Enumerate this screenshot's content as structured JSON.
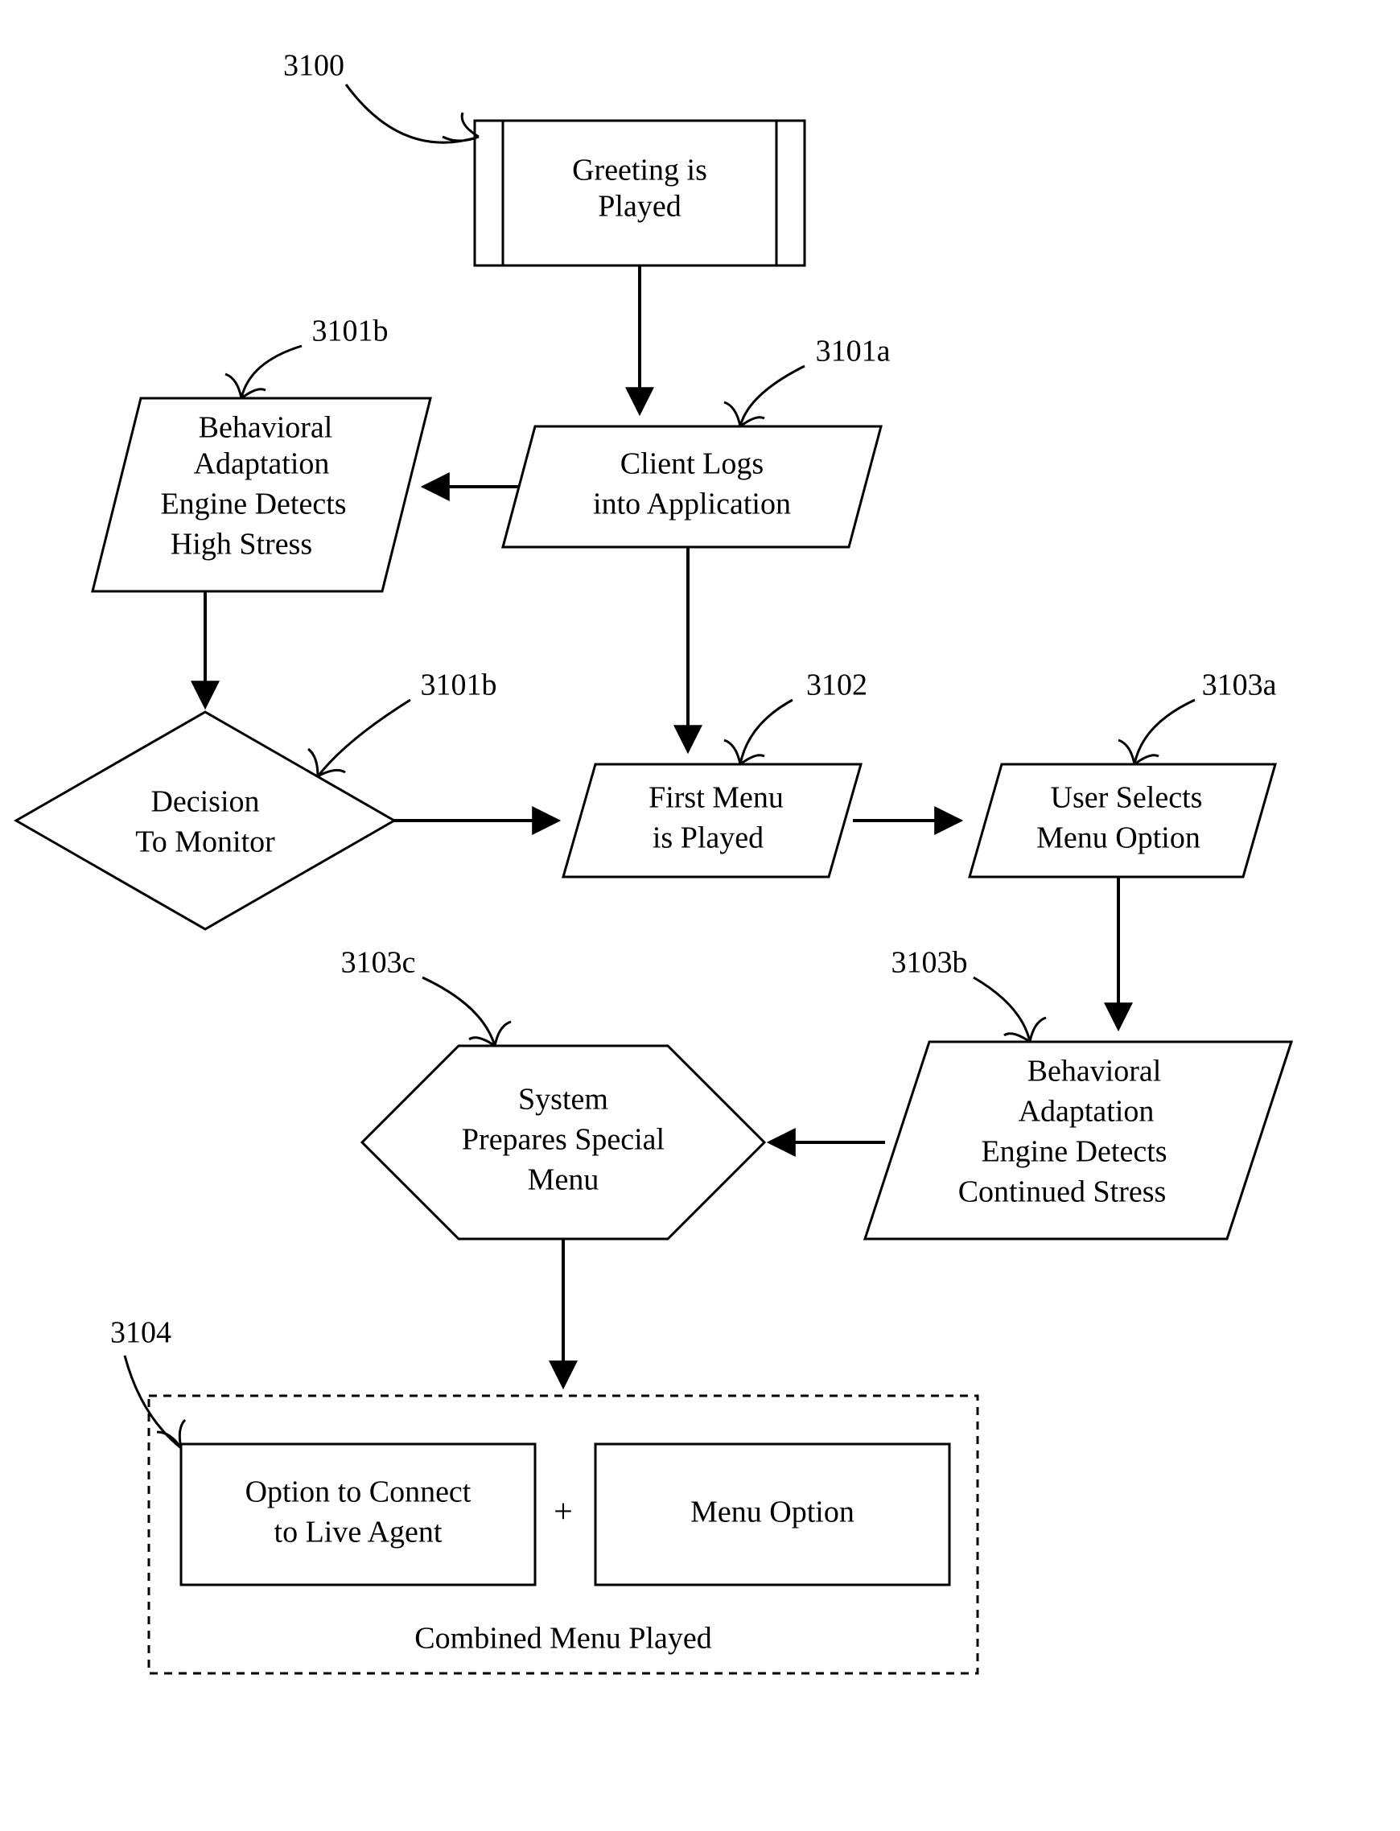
{
  "labels": {
    "l3100": "3100",
    "l3101b_top": "3101b",
    "l3101a": "3101a",
    "l3101b_mid": "3101b",
    "l3102": "3102",
    "l3103a": "3103a",
    "l3103c": "3103c",
    "l3103b": "3103b",
    "l3104": "3104"
  },
  "nodes": {
    "greeting": {
      "l1": "Greeting is",
      "l2": "Played"
    },
    "stress1": {
      "l1": "Behavioral",
      "l2": "Adaptation",
      "l3": "Engine Detects",
      "l4": "High Stress"
    },
    "login": {
      "l1": "Client Logs",
      "l2": "into Application"
    },
    "decision": {
      "l1": "Decision",
      "l2": "To Monitor"
    },
    "firstmenu": {
      "l1": "First Menu",
      "l2": "is Played"
    },
    "userselect": {
      "l1": "User Selects",
      "l2": "Menu Option"
    },
    "prepare": {
      "l1": "System",
      "l2": "Prepares Special",
      "l3": "Menu"
    },
    "stress2": {
      "l1": "Behavioral",
      "l2": "Adaptation",
      "l3": "Engine Detects",
      "l4": "Continued Stress"
    },
    "combined": {
      "left": {
        "l1": "Option to Connect",
        "l2": "to Live Agent"
      },
      "plus": "+",
      "right": "Menu Option",
      "caption": "Combined Menu Played"
    }
  }
}
